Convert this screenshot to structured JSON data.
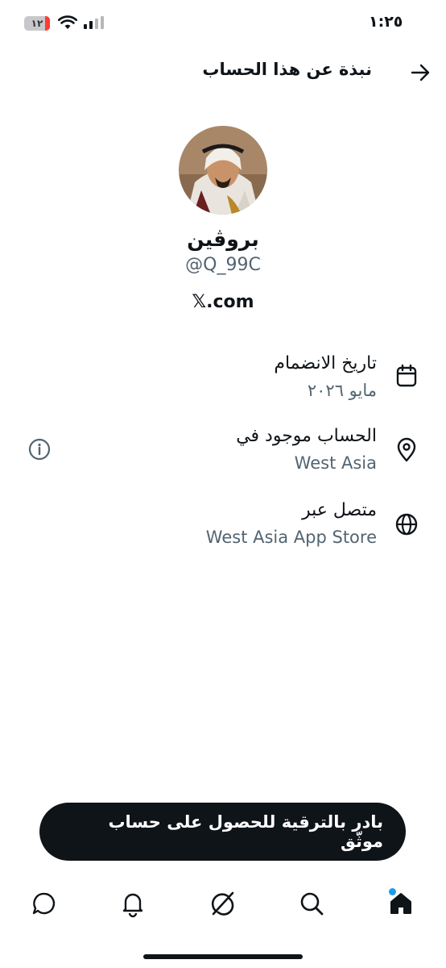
{
  "status_bar": {
    "time": "١:٢٥",
    "battery_level": "١٢"
  },
  "header": {
    "title": "نبذة عن هذا الحساب"
  },
  "profile": {
    "display_name": "بروڤين",
    "handle": "@Q_99C",
    "website": "𝕏.com"
  },
  "info_rows": [
    {
      "label": "تاريخ الانضمام",
      "value": "مايو ٢٠٢٦",
      "icon": "calendar-icon"
    },
    {
      "label": "الحساب موجود في",
      "value": "West Asia",
      "icon": "location-pin-icon"
    },
    {
      "label": "متصل عبر",
      "value": "West Asia App Store",
      "icon": "globe-icon"
    }
  ],
  "banner": {
    "text": "بادر بالترقية للحصول على حساب موثّق"
  },
  "tab_bar": {
    "items": [
      "home-icon",
      "search-icon",
      "grok-icon",
      "notifications-icon",
      "messages-icon"
    ]
  },
  "colors": {
    "primary_text": "#0f1419",
    "secondary_text": "#536471",
    "accent": "#1d9bf0",
    "battery_low": "#ff3b30"
  }
}
